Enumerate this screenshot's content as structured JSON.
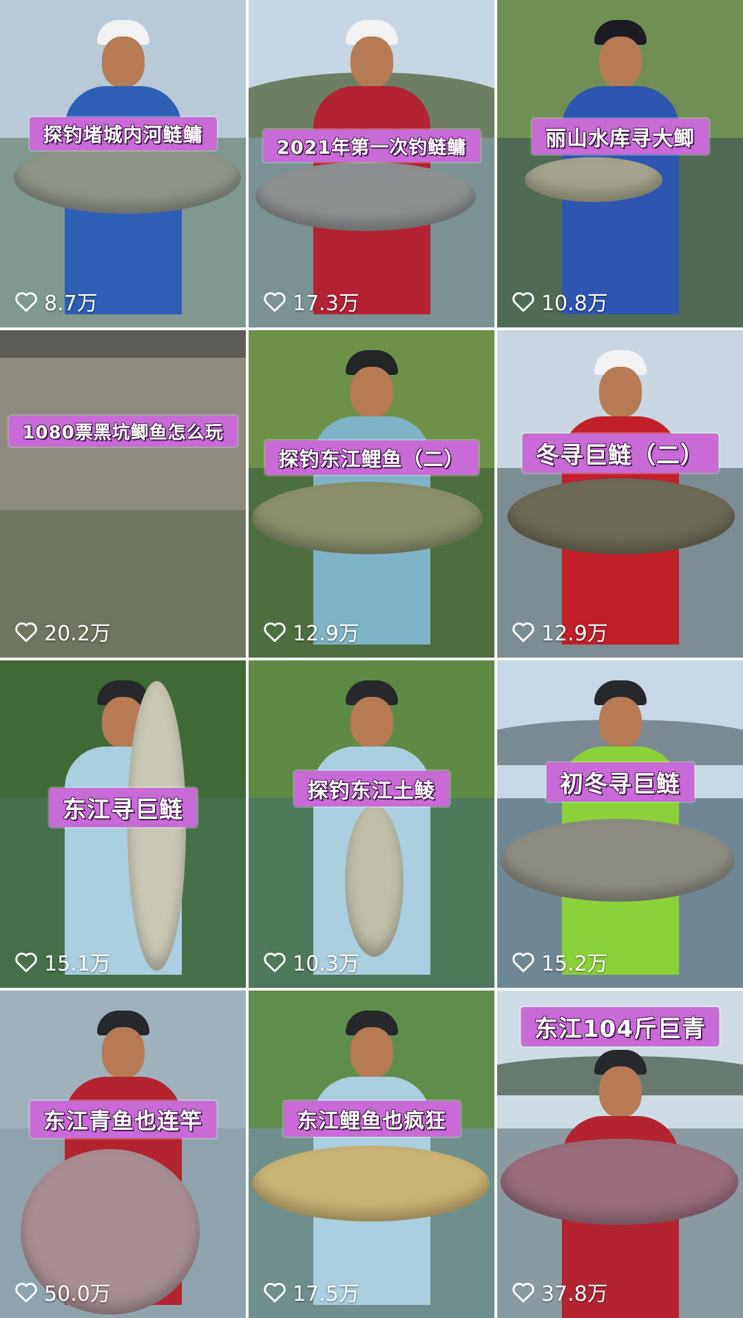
{
  "videos": [
    {
      "title": "探钓堵城内河鲢鳙",
      "likes": "8.7万"
    },
    {
      "title": "2021年第一次钓鲢鳙",
      "likes": "17.3万"
    },
    {
      "title": "丽山水库寻大鲫",
      "likes": "10.8万"
    },
    {
      "title": "1080票黑坑鲫鱼怎么玩",
      "likes": "20.2万"
    },
    {
      "title": "探钓东江鲤鱼（二）",
      "likes": "12.9万"
    },
    {
      "title": "冬寻巨鲢（二）",
      "likes": "12.9万"
    },
    {
      "title": "东江寻巨鲢",
      "likes": "15.1万"
    },
    {
      "title": "探钓东江土鲮",
      "likes": "10.3万"
    },
    {
      "title": "初冬寻巨鲢",
      "likes": "15.2万"
    },
    {
      "title": "东江青鱼也连竿",
      "likes": "50.0万"
    },
    {
      "title": "东江鲤鱼也疯狂",
      "likes": "17.5万"
    },
    {
      "title": "东江104斤巨青",
      "likes": "37.8万"
    }
  ],
  "icons": {
    "like": "heart-outline-icon"
  },
  "colors": {
    "banner": "#c86bd6",
    "banner_shadow": "#4a1a55",
    "text": "#ffffff"
  }
}
